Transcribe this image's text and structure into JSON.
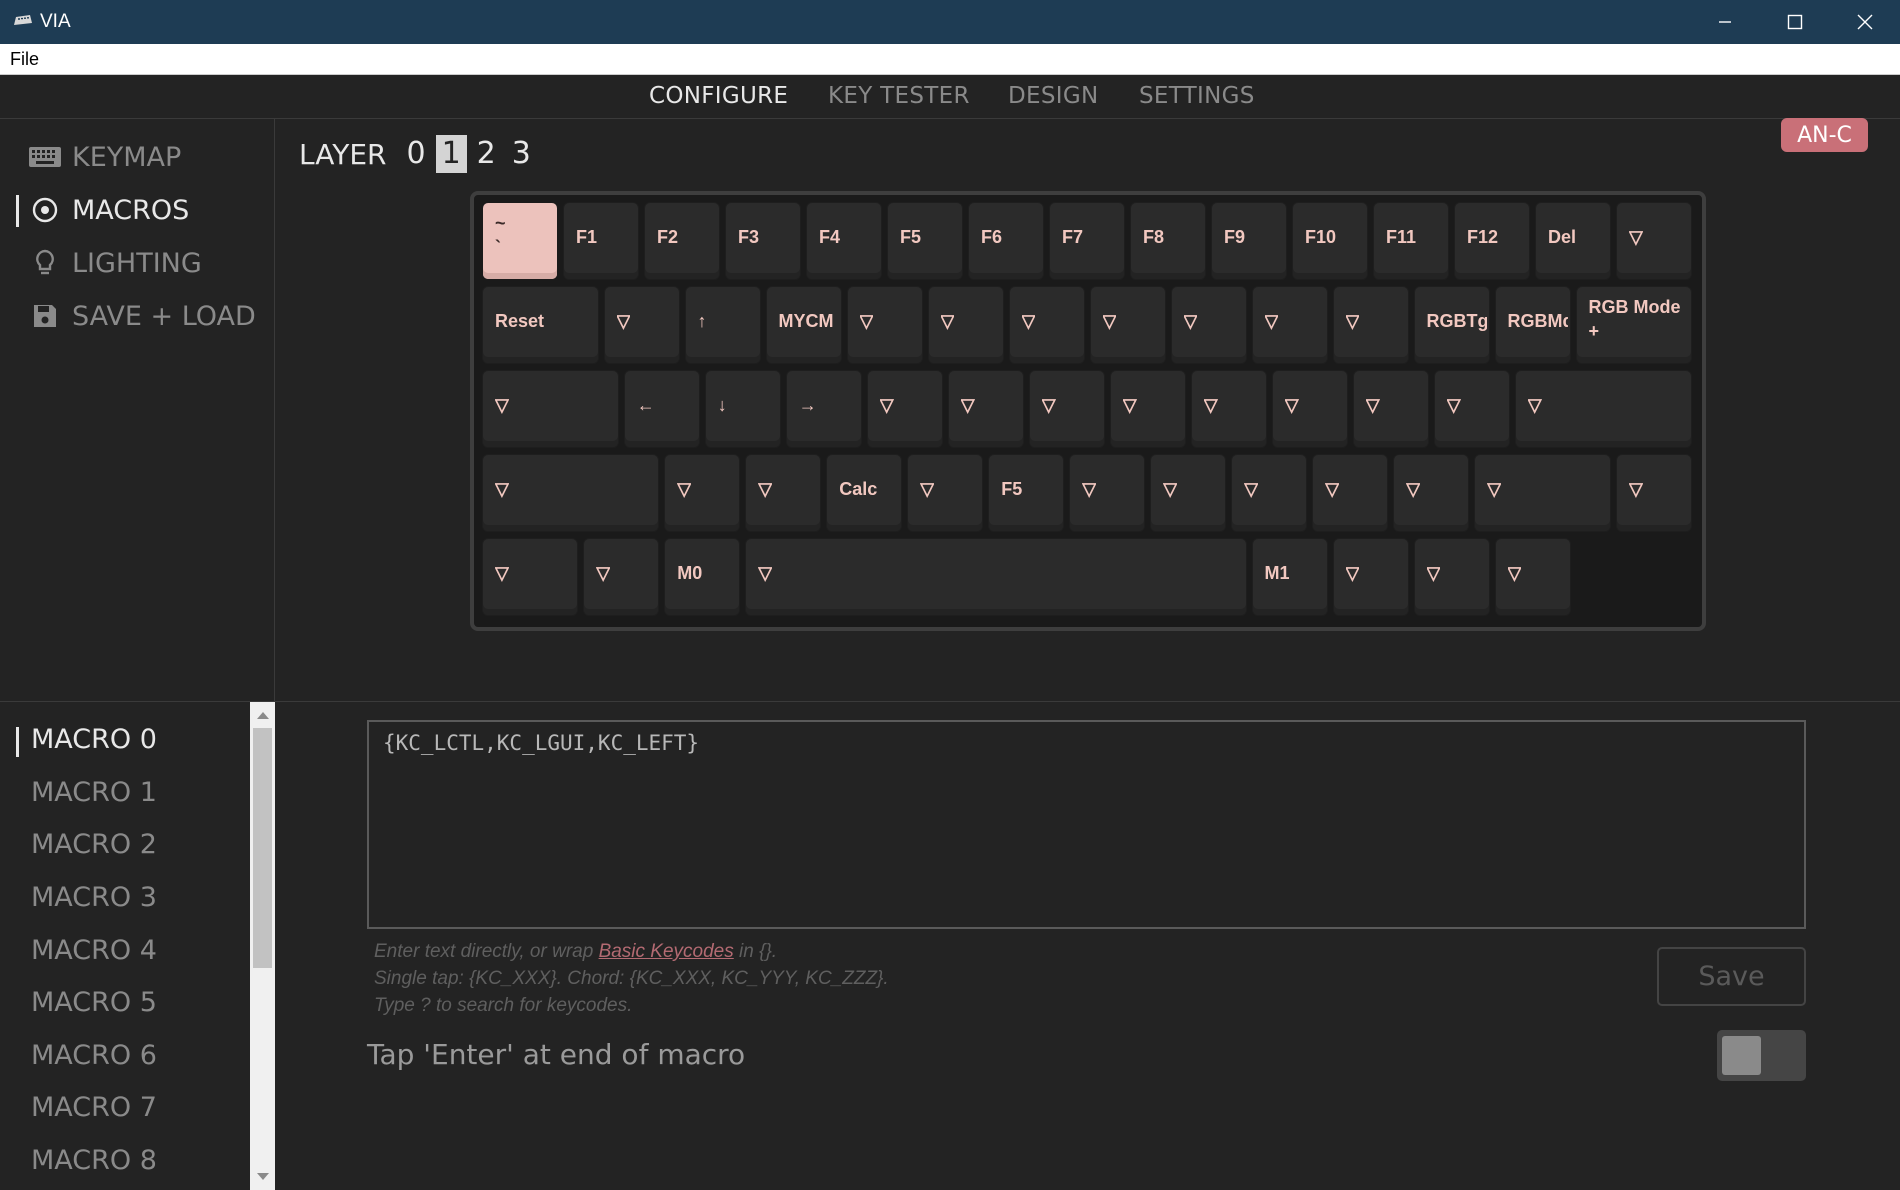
{
  "window": {
    "title": "VIA",
    "icon": "keyboard-app-icon",
    "controls": [
      "minimize-icon",
      "maximize-icon",
      "close-icon"
    ]
  },
  "menubar": {
    "file_label": "File"
  },
  "topnav": {
    "tabs": [
      {
        "label": "CONFIGURE",
        "active": true
      },
      {
        "label": "KEY TESTER",
        "active": false
      },
      {
        "label": "DESIGN",
        "active": false
      },
      {
        "label": "SETTINGS",
        "active": false
      }
    ]
  },
  "sidebar": {
    "items": [
      {
        "label": "KEYMAP",
        "icon": "keyboard-icon",
        "active": false
      },
      {
        "label": "MACROS",
        "icon": "target-icon",
        "active": true
      },
      {
        "label": "LIGHTING",
        "icon": "bulb-icon",
        "active": false
      },
      {
        "label": "SAVE + LOAD",
        "icon": "floppy-icon",
        "active": false
      }
    ]
  },
  "layers": {
    "label": "LAYER",
    "numbers": [
      "0",
      "1",
      "2",
      "3"
    ],
    "active_index": 1
  },
  "device_badge": "AN-C",
  "keyboard": {
    "rows": [
      [
        "~\n`",
        "F1",
        "F2",
        "F3",
        "F4",
        "F5",
        "F6",
        "F7",
        "F8",
        "F9",
        "F10",
        "F11",
        "F12",
        "Del",
        "▽"
      ],
      [
        "Reset",
        "▽",
        "↑",
        "MYCM",
        "▽",
        "▽",
        "▽",
        "▽",
        "▽",
        "▽",
        "▽",
        "RGBTgg",
        "RGBMd-",
        "RGB Mode\n+"
      ],
      [
        "▽",
        "←",
        "↓",
        "→",
        "▽",
        "▽",
        "▽",
        "▽",
        "▽",
        "▽",
        "▽",
        "▽",
        "▽"
      ],
      [
        "▽",
        "▽",
        "▽",
        "Calc",
        "▽",
        "F5",
        "▽",
        "▽",
        "▽",
        "▽",
        "▽",
        "▽",
        "▽"
      ],
      [
        "▽",
        "▽",
        "M0",
        "▽",
        "M1",
        "▽",
        "▽",
        "▽"
      ]
    ],
    "selected_key": "~\n`"
  },
  "macros": {
    "items": [
      "MACRO 0",
      "MACRO 1",
      "MACRO 2",
      "MACRO 3",
      "MACRO 4",
      "MACRO 5",
      "MACRO 6",
      "MACRO 7",
      "MACRO 8"
    ],
    "active_index": 0
  },
  "editor": {
    "value": "{KC_LCTL,KC_LGUI,KC_LEFT}",
    "help_prefix": "Enter text directly, or wrap ",
    "help_link": "Basic Keycodes",
    "help_suffix": " in {}.",
    "help_line2": "Single tap: {KC_XXX}. Chord: {KC_XXX, KC_YYY, KC_ZZZ}.",
    "help_line3": "Type ? to search for keycodes.",
    "save_label": "Save",
    "enter_label": "Tap 'Enter' at end of macro",
    "enter_toggle_on": false
  },
  "colors": {
    "titlebar": "#1e3c54",
    "background": "#232323",
    "key_legend": "#f2c8c0",
    "selected_key": "#ecc2bc",
    "badge": "#c97078"
  }
}
